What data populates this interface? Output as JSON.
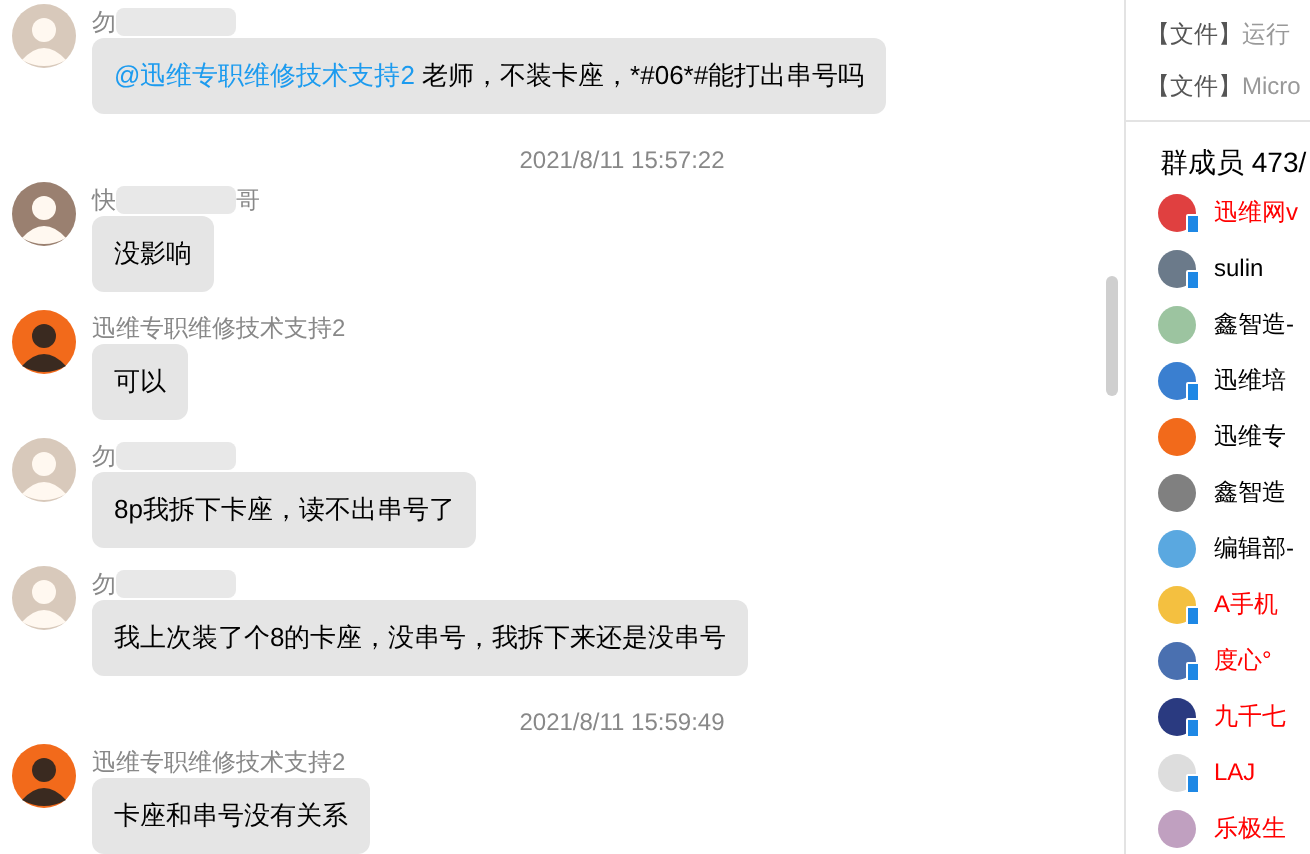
{
  "chat": [
    {
      "kind": "message",
      "sender": "勿",
      "redacted": true,
      "parts": [
        {
          "kind": "mention",
          "text": "@迅维专职维修技术支持2"
        },
        {
          "kind": "plain",
          "text": " 老师，不装卡座，*#06*#能打出串号吗"
        }
      ]
    },
    {
      "kind": "time",
      "text": "2021/8/11 15:57:22"
    },
    {
      "kind": "message",
      "sender": "快",
      "sender_tail": "哥",
      "redacted": true,
      "parts": [
        {
          "kind": "plain",
          "text": "没影响"
        }
      ]
    },
    {
      "kind": "message",
      "sender": "迅维专职维修技术支持2",
      "redacted": false,
      "parts": [
        {
          "kind": "plain",
          "text": "可以"
        }
      ]
    },
    {
      "kind": "message",
      "sender": "勿",
      "redacted": true,
      "parts": [
        {
          "kind": "plain",
          "text": "8p我拆下卡座，读不出串号了"
        }
      ]
    },
    {
      "kind": "message",
      "sender": "勿",
      "redacted": true,
      "parts": [
        {
          "kind": "plain",
          "text": "我上次装了个8的卡座，没串号，我拆下来还是没串号"
        }
      ]
    },
    {
      "kind": "time",
      "text": "2021/8/11 15:59:49"
    },
    {
      "kind": "message",
      "sender": "迅维专职维修技术支持2",
      "redacted": false,
      "parts": [
        {
          "kind": "plain",
          "text": "卡座和串号没有关系"
        }
      ]
    }
  ],
  "files": [
    {
      "tag": "【文件】",
      "name": "运行"
    },
    {
      "tag": "【文件】",
      "name": "Micro"
    }
  ],
  "members_title": "群成员 473/",
  "members": [
    {
      "name": "迅维网v",
      "color": "#ff0000",
      "mobile": true
    },
    {
      "name": "sulin",
      "color": "#000000",
      "mobile": true
    },
    {
      "name": "鑫智造-",
      "color": "#000000",
      "mobile": false
    },
    {
      "name": "迅维培",
      "color": "#000000",
      "mobile": true
    },
    {
      "name": "迅维专",
      "color": "#000000",
      "mobile": false
    },
    {
      "name": "鑫智造",
      "color": "#000000",
      "mobile": false
    },
    {
      "name": "编辑部-",
      "color": "#000000",
      "mobile": false
    },
    {
      "name": "A手机",
      "color": "#ff0000",
      "mobile": true
    },
    {
      "name": "度心°",
      "color": "#ff0000",
      "mobile": true
    },
    {
      "name": "九千七",
      "color": "#ff0000",
      "mobile": true
    },
    {
      "name": "LAJ",
      "color": "#ff0000",
      "mobile": true
    },
    {
      "name": "乐极生",
      "color": "#ff0000",
      "mobile": false
    }
  ]
}
